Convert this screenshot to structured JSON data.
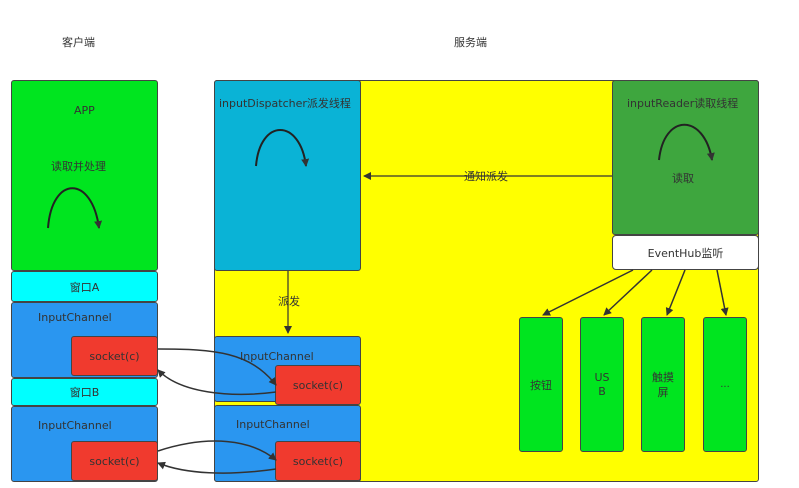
{
  "headers": {
    "client": "客户端",
    "server": "服务端"
  },
  "client": {
    "app_title": "APP",
    "app_subtitle": "读取并处理",
    "window_a": "窗口A",
    "window_b": "窗口B",
    "channel_a": {
      "title": "InputChannel",
      "socket": "socket(c)"
    },
    "channel_b": {
      "title": "InputChannel",
      "socket": "socket(c)"
    }
  },
  "server": {
    "dispatcher_title": "inputDispatcher派发线程",
    "reader_title": "inputReader读取线程",
    "reader_subtitle": "读取",
    "eventhub": "EventHub监听",
    "notify_label": "通知派发",
    "dispatch_label": "派发",
    "channel_a": {
      "title": "InputChannel",
      "socket": "socket(c)"
    },
    "channel_b": {
      "title": "InputChannel",
      "socket": "socket(c)"
    },
    "devices": [
      "按钮",
      "US\nB",
      "触摸\n屏",
      "..."
    ]
  },
  "colors": {
    "green": "#00e51f",
    "cyan": "#00ffff",
    "blue": "#2a96f0",
    "red": "#f03a2e",
    "yellow": "#ffff00",
    "teal": "#0ab3d6",
    "dark_green": "#3ea63e",
    "white": "#ffffff"
  }
}
